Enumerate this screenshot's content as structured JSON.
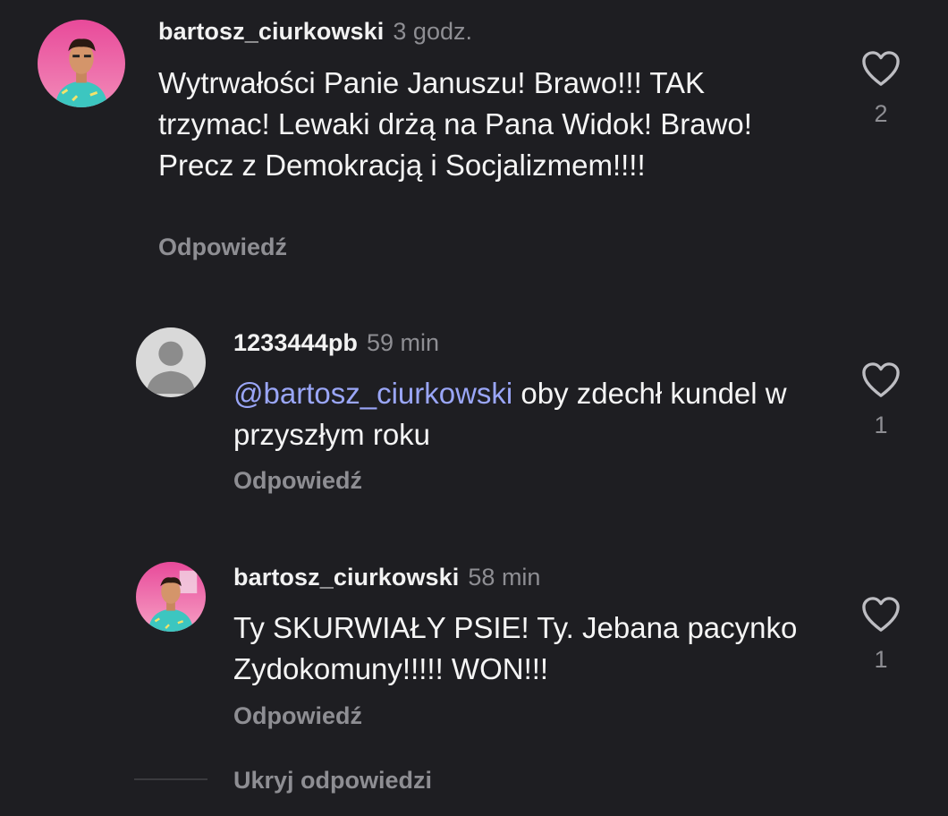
{
  "comments": [
    {
      "username": "bartosz_ciurkowski",
      "time": "3 godz.",
      "text": "Wytrwałości Panie Januszu! Brawo!!! TAK trzymac! Lewaki drżą na Pana Widok! Brawo! Precz z Demokracją i Socjalizmem!!!!",
      "reply_label": "Odpowiedź",
      "likes": "2",
      "avatar": "gta-character-avatar"
    },
    {
      "username": "1233444pb",
      "time": "59 min",
      "mention": "@bartosz_ciurkowski",
      "text": " oby zdechł kundel w przyszłym roku",
      "reply_label": "Odpowiedź",
      "likes": "1",
      "avatar": "default-user-avatar"
    },
    {
      "username": "bartosz_ciurkowski",
      "time": "58 min",
      "text": "Ty SKURWIAŁY PSIE! Ty. Jebana pacynko Zydokomuny!!!!! WON!!!",
      "reply_label": "Odpowiedź",
      "likes": "1",
      "avatar": "gta-character-avatar"
    }
  ],
  "hide_replies_label": "Ukryj odpowiedzi",
  "colors": {
    "background": "#1e1e22",
    "text": "#f5f5f5",
    "muted": "#8e8e93",
    "mention": "#9aa6f7"
  }
}
